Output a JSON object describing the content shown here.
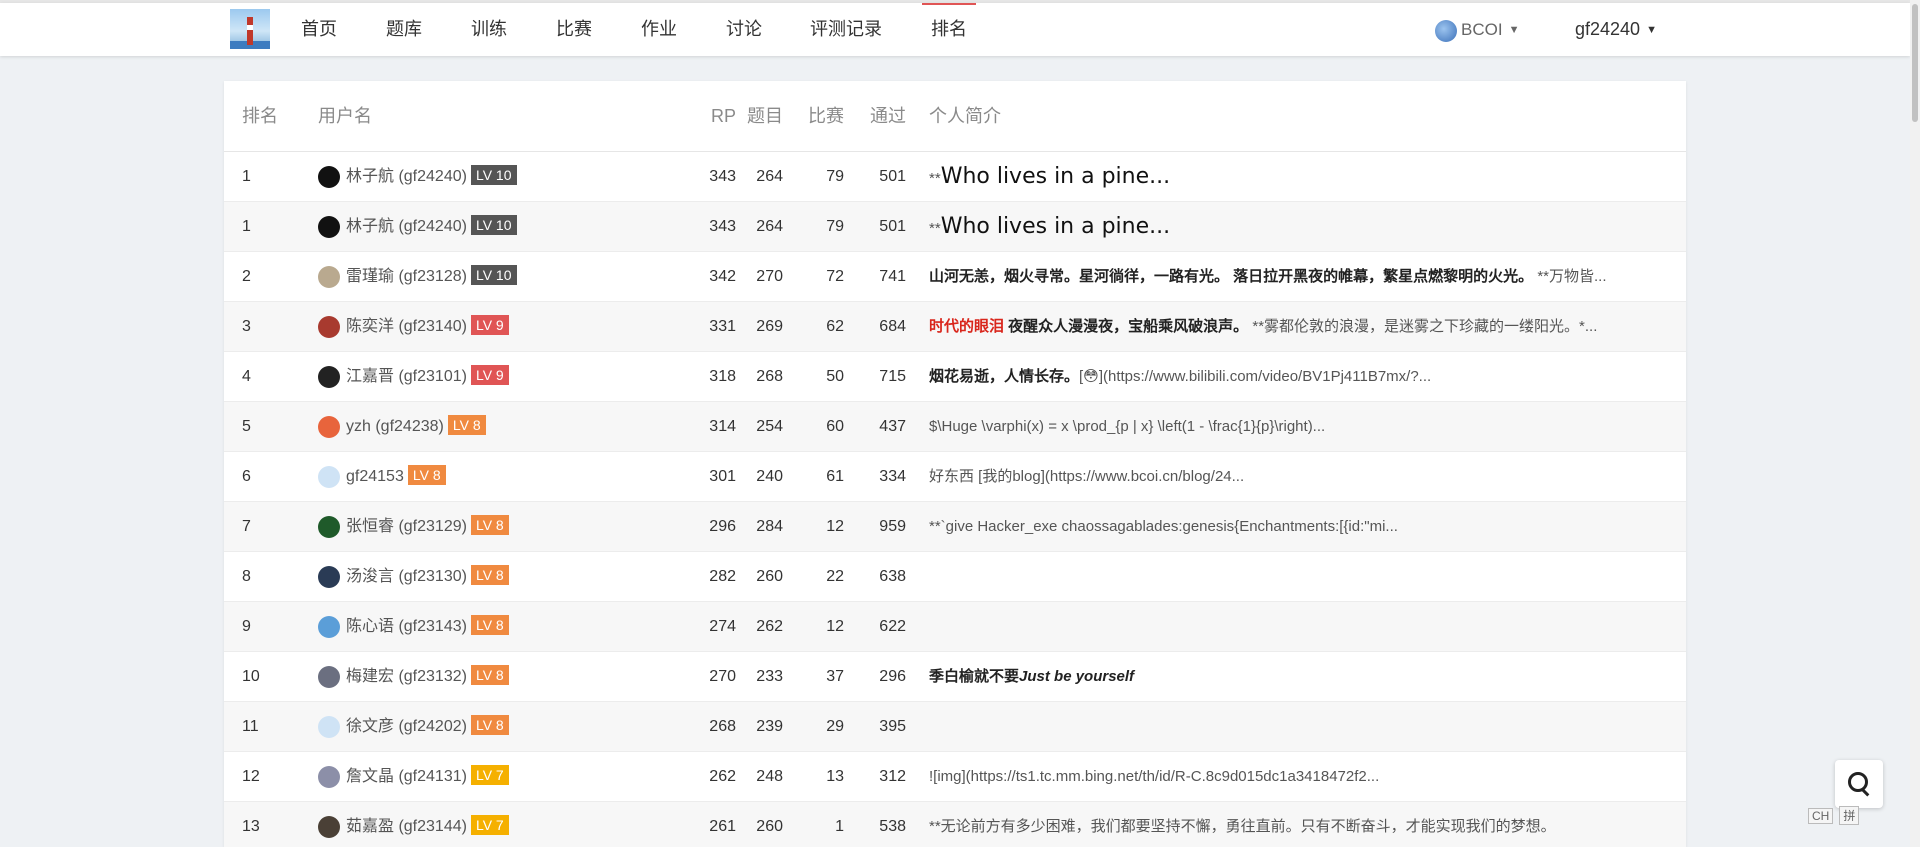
{
  "nav": {
    "items": [
      "首页",
      "题库",
      "训练",
      "比赛",
      "作业",
      "讨论",
      "评测记录",
      "排名"
    ],
    "active_index": 7,
    "domain": "BCOI",
    "user": "gf24240"
  },
  "table": {
    "headers": {
      "rank": "排名",
      "username": "用户名",
      "rp": "RP",
      "problems": "题目",
      "contests": "比赛",
      "accepted": "通过",
      "bio": "个人简介"
    },
    "rows": [
      {
        "rank": "1",
        "name": "林子航 (gf24240)",
        "lv": "LV 10",
        "lv_color": "#555555",
        "rp": "343",
        "problems": "264",
        "contests": "79",
        "accepted": "501",
        "bio_pre": "**",
        "bio_big": "Who lives in a pine...",
        "avatar_color": "#111111"
      },
      {
        "rank": "1",
        "name": "林子航 (gf24240)",
        "lv": "LV 10",
        "lv_color": "#555555",
        "rp": "343",
        "problems": "264",
        "contests": "79",
        "accepted": "501",
        "bio_pre": "**",
        "bio_big": "Who lives in a pine...",
        "avatar_color": "#111111"
      },
      {
        "rank": "2",
        "name": "雷瑾瑜 (gf23128)",
        "lv": "LV 10",
        "lv_color": "#555555",
        "rp": "342",
        "problems": "270",
        "contests": "72",
        "accepted": "741",
        "bio_bold": "山河无恙，烟火寻常。星河徜徉，一路有光。 落日拉开黑夜的帷幕，繁星点燃黎明的火光。",
        "bio_rest": " **万物皆...",
        "avatar_color": "#b9a98f"
      },
      {
        "rank": "3",
        "name": "陈奕洋 (gf23140)",
        "lv": "LV 9",
        "lv_color": "#e05555",
        "rp": "331",
        "problems": "269",
        "contests": "62",
        "accepted": "684",
        "bio_red": "时代的眼泪",
        "bio_bold": " 夜醒众人漫漫夜，宝船乘风破浪声。",
        "bio_rest": " **雾都伦敦的浪漫，是迷雾之下珍藏的一缕阳光。*...",
        "avatar_color": "#a83a2f"
      },
      {
        "rank": "4",
        "name": "江嘉晋 (gf23101)",
        "lv": "LV 9",
        "lv_color": "#e05555",
        "rp": "318",
        "problems": "268",
        "contests": "50",
        "accepted": "715",
        "bio_bold": "烟花易逝，人情长存。",
        "bio_rest": "[😳](https://www.bilibili.com/video/BV1Pj411B7mx/?...",
        "avatar_color": "#222222"
      },
      {
        "rank": "5",
        "name": "yzh (gf24238)",
        "lv": "LV 8",
        "lv_color": "#f08a40",
        "rp": "314",
        "problems": "254",
        "contests": "60",
        "accepted": "437",
        "bio_rest": "$\\Huge \\varphi(x) = x \\prod_{p | x} \\left(1 - \\frac{1}{p}\\right)...",
        "avatar_color": "#e8643c"
      },
      {
        "rank": "6",
        "name": "gf24153",
        "lv": "LV 8",
        "lv_color": "#f08a40",
        "rp": "301",
        "problems": "240",
        "contests": "61",
        "accepted": "334",
        "bio_rest": "好东西 [我的blog](https://www.bcoi.cn/blog/24...",
        "avatar_color": "#cfe3f5"
      },
      {
        "rank": "7",
        "name": "张恒睿 (gf23129)",
        "lv": "LV 8",
        "lv_color": "#f08a40",
        "rp": "296",
        "problems": "284",
        "contests": "12",
        "accepted": "959",
        "bio_rest": "**`give Hacker_exe chaossagablades:genesis{Enchantments:[{id:\"mi...",
        "avatar_color": "#1f5a2a"
      },
      {
        "rank": "8",
        "name": "汤浚言 (gf23130)",
        "lv": "LV 8",
        "lv_color": "#f08a40",
        "rp": "282",
        "problems": "260",
        "contests": "22",
        "accepted": "638",
        "bio_rest": "",
        "avatar_color": "#2a3b55"
      },
      {
        "rank": "9",
        "name": "陈心语 (gf23143)",
        "lv": "LV 8",
        "lv_color": "#f08a40",
        "rp": "274",
        "problems": "262",
        "contests": "12",
        "accepted": "622",
        "bio_rest": "",
        "avatar_color": "#5b9ed8"
      },
      {
        "rank": "10",
        "name": "梅建宏 (gf23132)",
        "lv": "LV 8",
        "lv_color": "#f08a40",
        "rp": "270",
        "problems": "233",
        "contests": "37",
        "accepted": "296",
        "bio_bold": "季白榆就不要",
        "bio_italic": "Just be yourself",
        "avatar_color": "#6b6f80"
      },
      {
        "rank": "11",
        "name": "徐文彦 (gf24202)",
        "lv": "LV 8",
        "lv_color": "#f08a40",
        "rp": "268",
        "problems": "239",
        "contests": "29",
        "accepted": "395",
        "bio_rest": "",
        "avatar_color": "#cfe3f5"
      },
      {
        "rank": "12",
        "name": "詹文晶 (gf24131)",
        "lv": "LV 7",
        "lv_color": "#f5b000",
        "rp": "262",
        "problems": "248",
        "contests": "13",
        "accepted": "312",
        "bio_rest": "![img](https://ts1.tc.mm.bing.net/th/id/R-C.8c9d015dc1a3418472f2...",
        "avatar_color": "#8c8fa8"
      },
      {
        "rank": "13",
        "name": "茹嘉盈 (gf23144)",
        "lv": "LV 7",
        "lv_color": "#f5b000",
        "rp": "261",
        "problems": "260",
        "contests": "1",
        "accepted": "538",
        "bio_rest": "**无论前方有多少困难，我们都要坚持不懈，勇往直前。只有不断奋斗，才能实现我们的梦想。",
        "avatar_color": "#4a4036"
      }
    ]
  },
  "ime": {
    "mode": "CH",
    "input": "拼"
  }
}
